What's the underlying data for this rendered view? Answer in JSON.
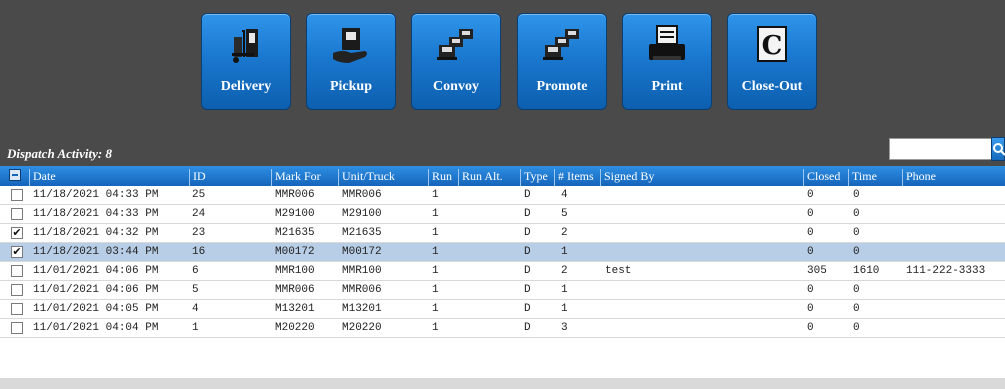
{
  "toolbar": {
    "buttons": [
      {
        "label": "Delivery",
        "icon": "hand-truck-delivery-icon"
      },
      {
        "label": "Pickup",
        "icon": "hand-box-pickup-icon"
      },
      {
        "label": "Convoy",
        "icon": "trucks-convoy-icon"
      },
      {
        "label": "Promote",
        "icon": "trucks-promote-icon"
      },
      {
        "label": "Print",
        "icon": "printer-icon"
      },
      {
        "label": "Close-Out",
        "icon": "close-out-c-icon"
      }
    ]
  },
  "activity": {
    "label": "Dispatch Activity: 8"
  },
  "search": {
    "value": "",
    "placeholder": "",
    "icon": "search-icon"
  },
  "grid": {
    "columns": [
      "Date",
      "ID",
      "Mark For",
      "Unit/Truck",
      "Run",
      "Run Alt.",
      "Type",
      "# Items",
      "Signed By",
      "Closed",
      "Time",
      "Phone"
    ],
    "rows": [
      {
        "checked": false,
        "selected": false,
        "date": "11/18/2021 04:33 PM",
        "id": "25",
        "mark_for": "MMR006",
        "unit": "MMR006",
        "run": "1",
        "run_alt": "",
        "type": "D",
        "items": "4",
        "signed_by": "",
        "closed": "0",
        "time": "0",
        "phone": ""
      },
      {
        "checked": false,
        "selected": false,
        "date": "11/18/2021 04:33 PM",
        "id": "24",
        "mark_for": "M29100",
        "unit": "M29100",
        "run": "1",
        "run_alt": "",
        "type": "D",
        "items": "5",
        "signed_by": "",
        "closed": "0",
        "time": "0",
        "phone": ""
      },
      {
        "checked": true,
        "selected": false,
        "date": "11/18/2021 04:32 PM",
        "id": "23",
        "mark_for": "M21635",
        "unit": "M21635",
        "run": "1",
        "run_alt": "",
        "type": "D",
        "items": "2",
        "signed_by": "",
        "closed": "0",
        "time": "0",
        "phone": ""
      },
      {
        "checked": true,
        "selected": true,
        "date": "11/18/2021 03:44 PM",
        "id": "16",
        "mark_for": "M00172",
        "unit": "M00172",
        "run": "1",
        "run_alt": "",
        "type": "D",
        "items": "1",
        "signed_by": "",
        "closed": "0",
        "time": "0",
        "phone": ""
      },
      {
        "checked": false,
        "selected": false,
        "date": "11/01/2021 04:06 PM",
        "id": "6",
        "mark_for": "MMR100",
        "unit": "MMR100",
        "run": "1",
        "run_alt": "",
        "type": "D",
        "items": "2",
        "signed_by": "test",
        "closed": "305",
        "time": "1610",
        "phone": "111-222-3333"
      },
      {
        "checked": false,
        "selected": false,
        "date": "11/01/2021 04:06 PM",
        "id": "5",
        "mark_for": "MMR006",
        "unit": "MMR006",
        "run": "1",
        "run_alt": "",
        "type": "D",
        "items": "1",
        "signed_by": "",
        "closed": "0",
        "time": "0",
        "phone": ""
      },
      {
        "checked": false,
        "selected": false,
        "date": "11/01/2021 04:05 PM",
        "id": "4",
        "mark_for": "M13201",
        "unit": "M13201",
        "run": "1",
        "run_alt": "",
        "type": "D",
        "items": "1",
        "signed_by": "",
        "closed": "0",
        "time": "0",
        "phone": ""
      },
      {
        "checked": false,
        "selected": false,
        "date": "11/01/2021 04:04 PM",
        "id": "1",
        "mark_for": "M20220",
        "unit": "M20220",
        "run": "1",
        "run_alt": "",
        "type": "D",
        "items": "3",
        "signed_by": "",
        "closed": "0",
        "time": "0",
        "phone": ""
      }
    ]
  },
  "colors": {
    "toolbar_bg": "#4a4a4a",
    "button_blue": "#1a78cf",
    "header_blue": "#1565ba",
    "selected_row": "#b8cde6"
  }
}
